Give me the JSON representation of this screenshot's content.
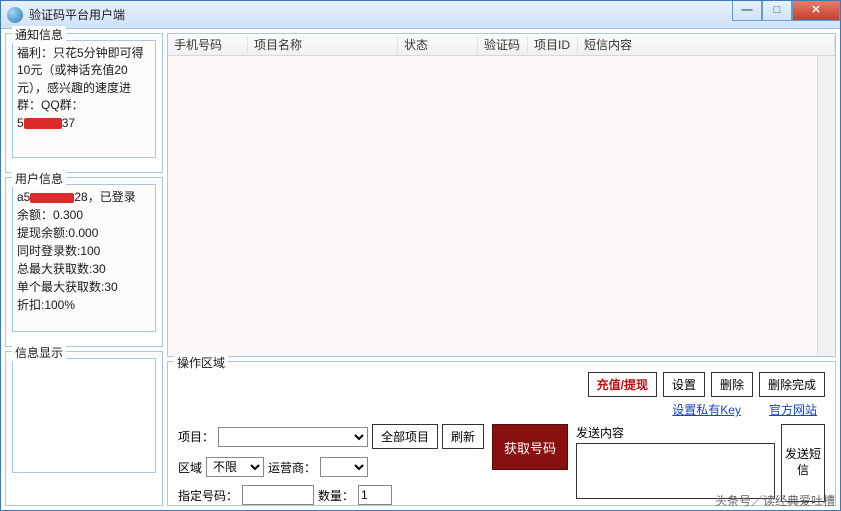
{
  "window": {
    "title": "验证码平台用户端"
  },
  "notify": {
    "legend": "通知信息",
    "line1": "福利：只花5分钟即可得",
    "line2": "10元（或神话充值20",
    "line3": "元），感兴趣的速度进",
    "line4": "群：QQ群：",
    "line5_prefix": "5",
    "line5_suffix": "37"
  },
  "userinfo": {
    "legend": "用户信息",
    "line1_prefix": "a5",
    "line1_suffix": "28，已登录",
    "balance": "余额：0.300",
    "withdraw": "提现余额:0.000",
    "concurrent": "同时登录数:100",
    "totalmax": "总最大获取数:30",
    "singlemax": "单个最大获取数:30",
    "discount": "折扣:100%"
  },
  "msgdisplay": {
    "legend": "信息显示"
  },
  "grid": {
    "cols": {
      "phone": "手机号码",
      "project": "项目名称",
      "status": "状态",
      "code": "验证码",
      "pid": "项目ID",
      "sms": "短信内容"
    }
  },
  "op": {
    "legend": "操作区域",
    "buttons": {
      "recharge": "充值/提现",
      "settings": "设置",
      "delete": "删除",
      "deleteDone": "删除完成"
    },
    "links": {
      "privkey": "设置私有Key",
      "site": "官方网站"
    },
    "labels": {
      "project": "项目：",
      "allproj": "全部项目",
      "refresh": "刷新",
      "area": "区域",
      "areaOpt": "不限",
      "carrier": "运营商：",
      "number": "指定号码：",
      "qty": "数量：",
      "qtyVal": "1",
      "getnum": "获取号码",
      "sendHeader": "发送内容",
      "sendBtn": "发送短信"
    }
  },
  "footer": "头条号／读经典爱吐槽"
}
